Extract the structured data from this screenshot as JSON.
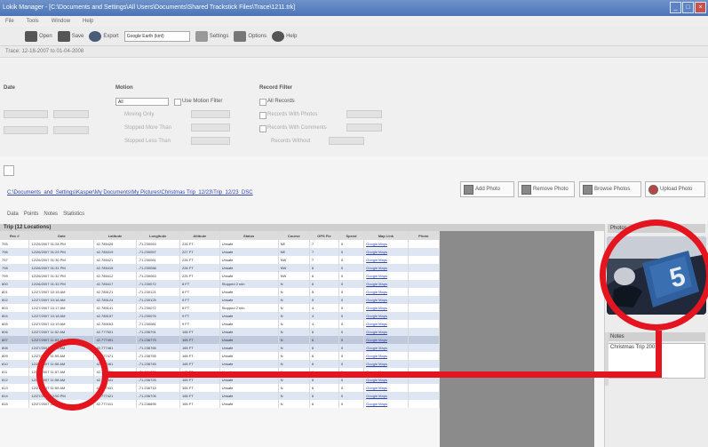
{
  "window": {
    "title": "Lokik Manager - [C:\\Documents and Settings\\All Users\\Documents\\Shared Trackstick Files\\Trace\\1211.trk]",
    "controls": [
      "_",
      "□",
      "×"
    ]
  },
  "menu": [
    "File",
    "Tools",
    "Window",
    "Help"
  ],
  "toolbar": {
    "buttons": [
      {
        "label": "Open",
        "icon": "camera-icon"
      },
      {
        "label": "Save",
        "icon": "save-icon"
      },
      {
        "label": "Export",
        "icon": "globe-icon"
      }
    ],
    "export_select": "Google Earth (kml)",
    "extra_buttons": [
      "Settings",
      "Options",
      "Help"
    ]
  },
  "breadcrumb": "Trace: 12-18-2007 to 01-04-2008",
  "filters": {
    "date_label": "Date",
    "date_from": "12/18/2007",
    "date_to": "01/04/2008",
    "motion_label": "Motion",
    "motion_value": "All",
    "motion_check": "Use Motion Filter",
    "motion_rows": [
      "Moving Only",
      "Stopped More Than",
      "Stopped Less Than"
    ],
    "record_label": "Record Filter",
    "record_rows": [
      "All Records",
      "Records With Photos",
      "Records With Comments",
      "Records Without"
    ]
  },
  "path": "C:\\Documents_and_Settings\\Kasper\\My Documents\\My Pictures\\Christmas Trip_12/23\\Trip_12/23_DSC",
  "photo_buttons": [
    "Add Photo",
    "Remove Photo",
    "Browse Photos",
    "Upload Photo"
  ],
  "subtabs": [
    "Data",
    "Points",
    "Notes",
    "Statistics"
  ],
  "grid": {
    "title": "Trip (12 Locations)",
    "columns": [
      "Rec #",
      "Date",
      "Latitude",
      "Longitude",
      "Altitude",
      "Status",
      "Course",
      "GPS Fix",
      "Speed",
      "Map Link",
      "Photo"
    ],
    "rows": [
      [
        "795",
        "12/26/2007 01:28 PM",
        "42.785426",
        "-71.230053",
        "226 FT",
        "Unsafe",
        "NE",
        "7",
        "0",
        "Google Maps",
        ""
      ],
      [
        "796",
        "12/26/2007 01:29 PM",
        "42.785419",
        "-71.230057",
        "227 FT",
        "Unsafe",
        "NE",
        "7",
        "0",
        "Google Maps",
        ""
      ],
      [
        "797",
        "12/26/2007 01:30 PM",
        "42.785421",
        "-71.230061",
        "226 FT",
        "Unsafe",
        "NW",
        "7",
        "0",
        "Google Maps",
        ""
      ],
      [
        "798",
        "12/26/2007 01:31 PM",
        "42.785415",
        "-71.230058",
        "226 FT",
        "Unsafe",
        "NW",
        "6",
        "0",
        "Google Maps",
        ""
      ],
      [
        "799",
        "12/26/2007 01:32 PM",
        "42.785412",
        "-71.230063",
        "225 FT",
        "Unsafe",
        "NW",
        "6",
        "0",
        "Google Maps",
        ""
      ],
      [
        "800",
        "12/26/2007 01:33 PM",
        "42.785417",
        "-71.230072",
        "8 FT",
        "Stopped 2 min",
        "N",
        "6",
        "0",
        "Google Maps",
        ""
      ],
      [
        "801",
        "12/27/2007 10:15 AM",
        "42.785121",
        "-71.230121",
        "8 FT",
        "Unsafe",
        "N",
        "5",
        "0",
        "Google Maps",
        ""
      ],
      [
        "802",
        "12/27/2007 10:16 AM",
        "42.785124",
        "-71.230125",
        "9 FT",
        "Unsafe",
        "N",
        "5",
        "0",
        "Google Maps",
        ""
      ],
      [
        "803",
        "12/27/2007 10:17 AM",
        "42.785141",
        "-71.230072",
        "8 FT",
        "Stopped 2 min",
        "N",
        "4",
        "0",
        "Google Maps",
        ""
      ],
      [
        "804",
        "12/27/2007 10:18 AM",
        "42.785157",
        "-71.230076",
        "9 FT",
        "Unsafe",
        "N",
        "4",
        "0",
        "Google Maps",
        ""
      ],
      [
        "805",
        "12/27/2007 10:19 AM",
        "42.785163",
        "-71.230081",
        "9 FT",
        "Unsafe",
        "N",
        "4",
        "0",
        "Google Maps",
        ""
      ],
      [
        "806",
        "12/27/2007 11:52 AM",
        "42.777501",
        "-71.236791",
        "165 FT",
        "Unsafe",
        "N",
        "6",
        "0",
        "Google Maps",
        ""
      ],
      [
        "807",
        "12/27/2007 11:53 AM",
        "42.777491",
        "-71.236775",
        "165 FT",
        "Unsafe",
        "N",
        "6",
        "0",
        "Google Maps",
        ""
      ],
      [
        "808",
        "12/27/2007 11:54 AM",
        "42.777481",
        "-71.236765",
        "165 FT",
        "Unsafe",
        "N",
        "6",
        "0",
        "Google Maps",
        ""
      ],
      [
        "809",
        "12/27/2007 11:55 AM",
        "42.777471",
        "-71.236755",
        "165 FT",
        "Unsafe",
        "N",
        "6",
        "0",
        "Google Maps",
        ""
      ],
      [
        "810",
        "12/27/2007 11:56 AM",
        "42.777461",
        "-71.236745",
        "165 FT",
        "Unsafe",
        "N",
        "6",
        "0",
        "Google Maps",
        ""
      ],
      [
        "811",
        "12/27/2007 11:57 AM",
        "42.777451",
        "-71.236735",
        "165 FT",
        "Unsafe",
        "N",
        "6",
        "0",
        "Google Maps",
        ""
      ],
      [
        "812",
        "12/27/2007 11:58 AM",
        "42.777441",
        "-71.236725",
        "165 FT",
        "Unsafe",
        "N",
        "6",
        "0",
        "Google Maps",
        ""
      ],
      [
        "813",
        "12/27/2007 11:59 AM",
        "42.777431",
        "-71.236715",
        "165 FT",
        "Unsafe",
        "N",
        "6",
        "0",
        "Google Maps",
        ""
      ],
      [
        "814",
        "12/27/2007 12:00 PM",
        "42.777421",
        "-71.236705",
        "165 FT",
        "Unsafe",
        "N",
        "6",
        "0",
        "Google Maps",
        ""
      ],
      [
        "815",
        "12/27/2007 12:01 PM",
        "42.777411",
        "-71.236695",
        "165 FT",
        "Unsafe",
        "N",
        "6",
        "0",
        "Google Maps",
        ""
      ]
    ],
    "selected_row": 12
  },
  "side_panel": {
    "photo_header": "Photos",
    "notes_header": "Notes",
    "notes_field": "Christmas Trip 2007",
    "jersey_number": "5"
  },
  "colors": {
    "highlight_red": "#e51520",
    "title_blue": "#4a74b8",
    "row_alt": "#dfe6f3"
  }
}
